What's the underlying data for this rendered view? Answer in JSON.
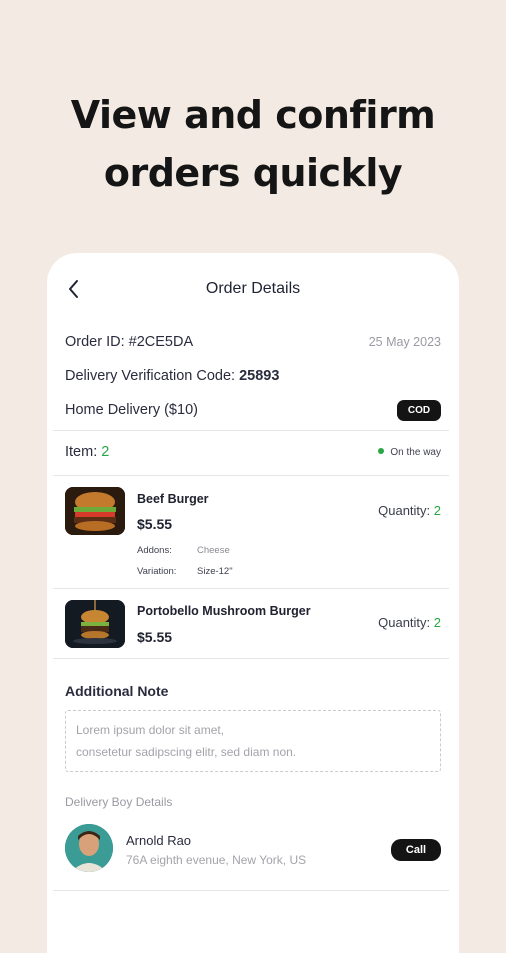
{
  "headline": {
    "line1": "View and confirm",
    "line2": "orders quickly"
  },
  "header": {
    "title": "Order Details"
  },
  "order": {
    "id_label": "Order ID: #2CE5DA",
    "date": "25 May 2023",
    "verification_label": "Delivery Verification Code: ",
    "verification_code": "25893",
    "delivery_type": "Home Delivery ($10)",
    "payment_badge": "COD",
    "item_label": "Item: ",
    "item_count": "2",
    "status": "On the way"
  },
  "items": [
    {
      "name": "Beef Burger",
      "price": "$5.55",
      "quantity_label": "Quantity: ",
      "quantity": "2",
      "addons_label": "Addons:",
      "addons_value": "Cheese",
      "variation_label": "Variation:",
      "variation_value": "Size-12\""
    },
    {
      "name": "Portobello Mushroom Burger",
      "price": "$5.55",
      "quantity_label": "Quantity: ",
      "quantity": "2"
    }
  ],
  "note": {
    "title": "Additional Note",
    "line1": "Lorem ipsum dolor sit amet,",
    "line2": "consetetur sadipscing elitr, sed diam non."
  },
  "delivery_boy": {
    "section_label": "Delivery Boy Details",
    "name": "Arnold Rao",
    "address": "76A eighth evenue, New York, US",
    "call_label": "Call"
  },
  "colors": {
    "background": "#f3ebe3",
    "accent_green": "#29a745",
    "dark": "#141414"
  },
  "icons": {
    "back": "chevron-left-icon",
    "status_dot": "status-dot-icon"
  }
}
